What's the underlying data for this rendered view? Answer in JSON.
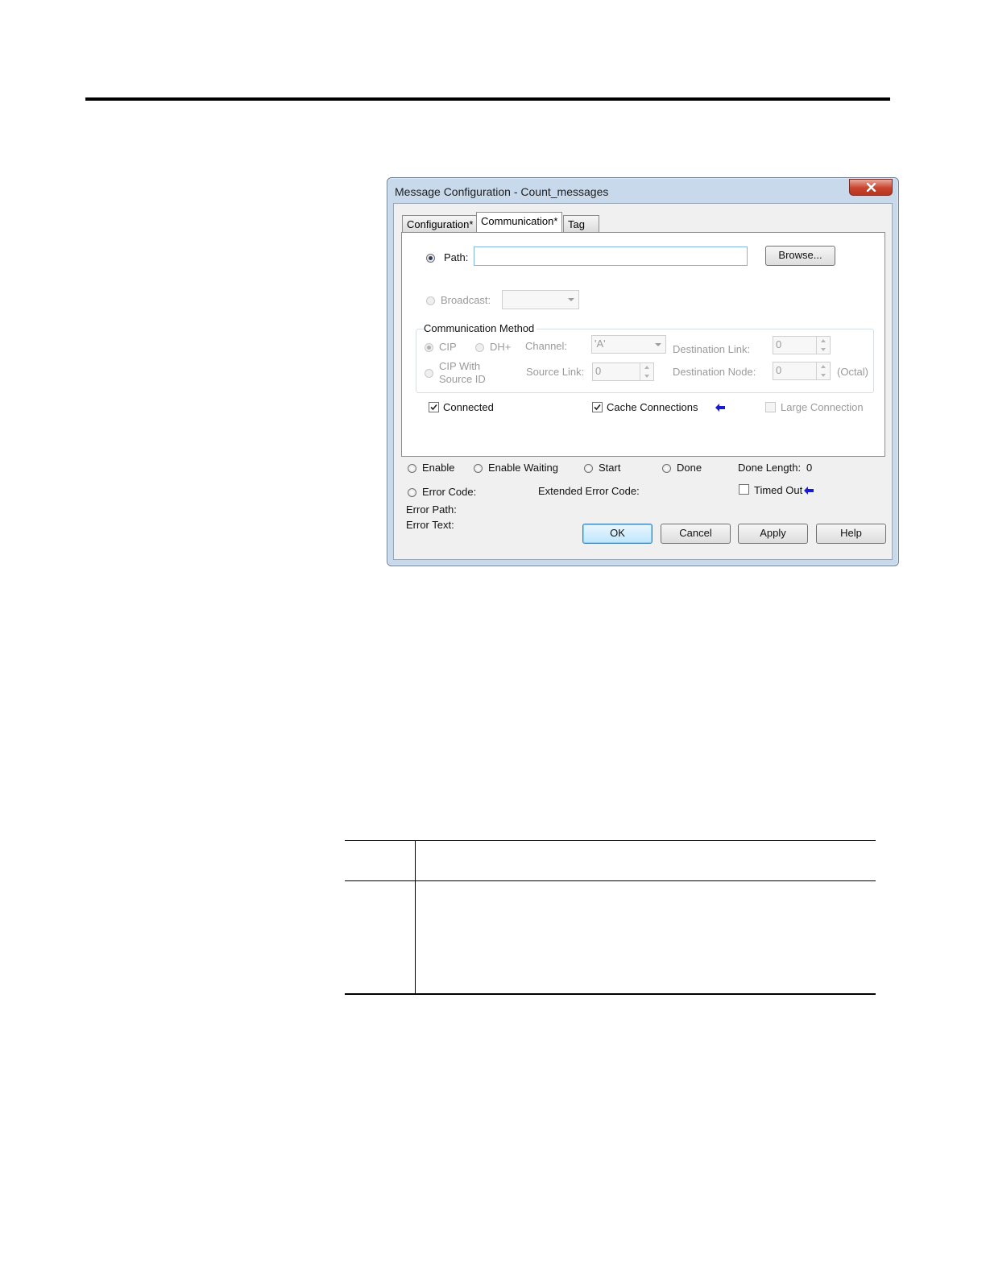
{
  "dialog": {
    "title": "Message Configuration - Count_messages",
    "tabs": [
      "Configuration*",
      "Communication*",
      "Tag"
    ],
    "path_label": "Path:",
    "path_value": "",
    "browse_label": "Browse...",
    "broadcast_label": "Broadcast:",
    "comm_method": {
      "title": "Communication Method",
      "cip": "CIP",
      "dhplus": "DH+",
      "channel_label": "Channel:",
      "channel_value": "'A'",
      "dest_link_label": "Destination Link:",
      "dest_link_value": "0",
      "cip_source_line1": "CIP With",
      "cip_source_line2": "Source ID",
      "source_link_label": "Source Link:",
      "source_link_value": "0",
      "dest_node_label": "Destination Node:",
      "dest_node_value": "0",
      "octal_label": "(Octal)"
    },
    "connected_label": "Connected",
    "cache_label": "Cache Connections",
    "large_label": "Large Connection",
    "status": {
      "enable": "Enable",
      "enable_waiting": "Enable Waiting",
      "start": "Start",
      "done": "Done",
      "done_length_label": "Done Length:",
      "done_length_value": "0",
      "error_code": "Error Code:",
      "extended_error_code": "Extended Error Code:",
      "timed_out": "Timed Out",
      "error_path": "Error Path:",
      "error_text": "Error Text:"
    },
    "buttons": {
      "ok": "OK",
      "cancel": "Cancel",
      "apply": "Apply",
      "help": "Help"
    },
    "colors": {
      "accent_arrow": "#1a1ad0",
      "frame": "#c9d9ec",
      "close": "#c8432c"
    }
  }
}
